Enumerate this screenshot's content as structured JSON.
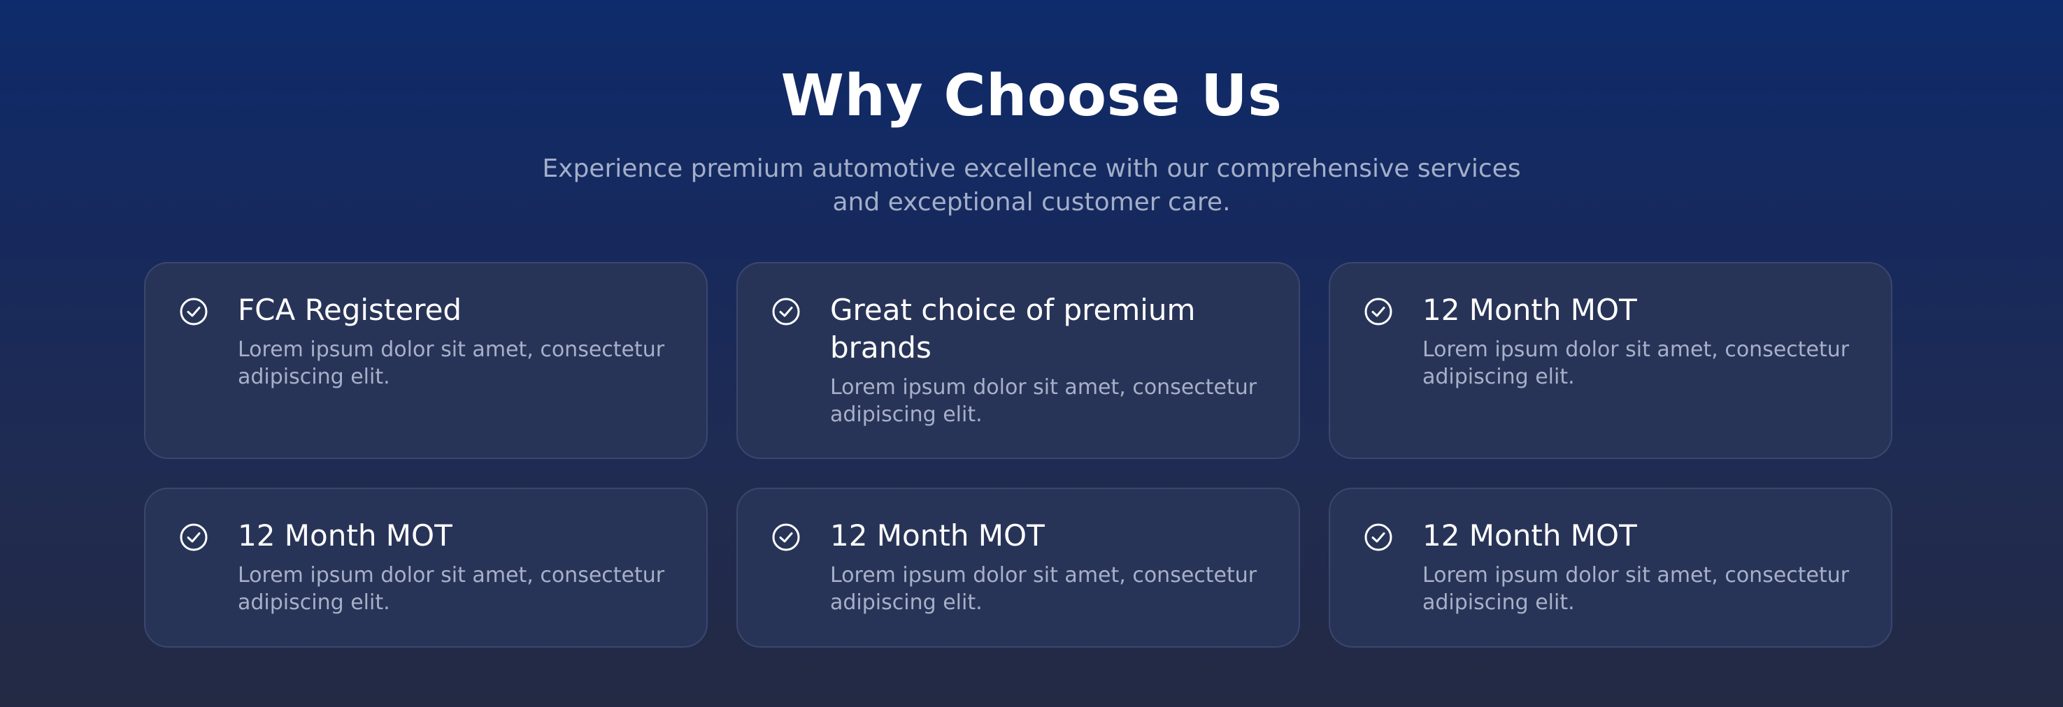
{
  "section": {
    "title": "Why Choose Us",
    "subtitle": "Experience premium automotive excellence with our comprehensive services and exceptional customer care."
  },
  "features": [
    {
      "title": "FCA Registered",
      "text": "Lorem ipsum dolor sit amet, consectetur adipiscing elit.",
      "icon": "check-circle-icon"
    },
    {
      "title": "Great choice of premium brands",
      "text": "Lorem ipsum dolor sit amet, consectetur adipiscing elit.",
      "icon": "check-circle-icon"
    },
    {
      "title": "12 Month MOT",
      "text": "Lorem ipsum dolor sit amet, consectetur adipiscing elit.",
      "icon": "check-circle-icon"
    },
    {
      "title": "12 Month MOT",
      "text": "Lorem ipsum dolor sit amet, consectetur adipiscing elit.",
      "icon": "check-circle-icon"
    },
    {
      "title": "12 Month MOT",
      "text": "Lorem ipsum dolor sit amet, consectetur adipiscing elit.",
      "icon": "check-circle-icon"
    },
    {
      "title": "12 Month MOT",
      "text": "Lorem ipsum dolor sit amet, consectetur adipiscing elit.",
      "icon": "check-circle-icon"
    }
  ],
  "colors": {
    "background_top": "#0e2b6b",
    "background_bottom": "#232a44",
    "card_background": "#283457",
    "card_border": "#3b4670",
    "muted_text": "#a7b0c8"
  }
}
